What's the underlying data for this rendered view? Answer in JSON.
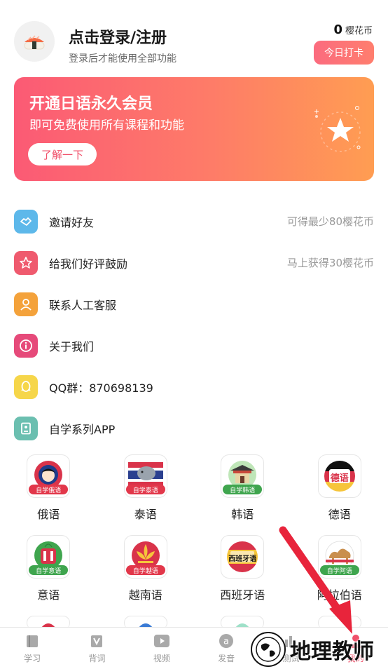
{
  "header": {
    "title": "点击登录/注册",
    "subtitle": "登录后才能使用全部功能",
    "coin_count": "0",
    "coin_unit": "樱花币",
    "checkin_label": "今日打卡"
  },
  "banner": {
    "title": "开通日语永久会员",
    "subtitle": "即可免费使用所有课程和功能",
    "button_label": "了解一下"
  },
  "menu": [
    {
      "label": "邀请好友",
      "right": "可得最少80樱花币",
      "color": "#5db8ea",
      "icon": "handshake-icon"
    },
    {
      "label": "给我们好评鼓励",
      "right": "马上获得30樱花币",
      "color": "#ef5a6e",
      "icon": "star-badge-icon"
    },
    {
      "label": "联系人工客服",
      "right": "",
      "color": "#f4a23b",
      "icon": "person-icon"
    },
    {
      "label": "关于我们",
      "right": "",
      "color": "#e64a7a",
      "icon": "info-icon"
    },
    {
      "label": "QQ群：870698139",
      "right": "",
      "color": "#f6d64a",
      "icon": "qq-icon"
    },
    {
      "label": "自学系列APP",
      "right": "",
      "color": "#6bbfb0",
      "icon": "app-book-icon"
    }
  ],
  "apps": [
    {
      "label": "俄语",
      "tag": "自学俄语",
      "tag_color": "#e2374a"
    },
    {
      "label": "泰语",
      "tag": "自学泰语",
      "tag_color": "#e2374a"
    },
    {
      "label": "韩语",
      "tag": "自学韩语",
      "tag_color": "#3fa54e"
    },
    {
      "label": "德语",
      "tag": "德语",
      "tag_color": "#e2374a"
    },
    {
      "label": "意语",
      "tag": "自学意语",
      "tag_color": "#3fa54e"
    },
    {
      "label": "越南语",
      "tag": "自学越语",
      "tag_color": "#e2374a"
    },
    {
      "label": "西班牙语",
      "tag": "西班牙语",
      "tag_color": "#e2374a"
    },
    {
      "label": "阿拉伯语",
      "tag": "自学阿语",
      "tag_color": "#3fa54e"
    }
  ],
  "nav": [
    {
      "label": "学习",
      "icon": "book-icon"
    },
    {
      "label": "背词",
      "icon": "word-card-icon"
    },
    {
      "label": "视频",
      "icon": "play-icon"
    },
    {
      "label": "发音",
      "icon": "a-circle-icon"
    },
    {
      "label": "测试",
      "icon": "chart-icon"
    },
    {
      "label": "我的",
      "icon": "user-icon"
    }
  ],
  "watermark": {
    "text": "地理教师"
  },
  "colors": {
    "accent": "#f0506a",
    "banner_start": "#fb5a75",
    "banner_end": "#ff9d52"
  }
}
